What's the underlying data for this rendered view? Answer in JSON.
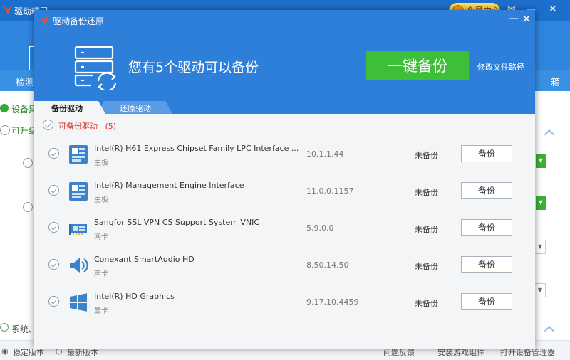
{
  "background": {
    "title": "驱动精灵",
    "vip_label": "会员中心",
    "nav": {
      "left": "检测",
      "right": "箱"
    },
    "rows": {
      "device_exception": "设备异",
      "upgradable": "可升级",
      "system": "系统、"
    },
    "statusbar": {
      "stable": "稳定版本",
      "latest": "最新版本",
      "feedback": "问题反馈",
      "install_game": "安装游戏组件",
      "device_manager": "打开设备管理器"
    }
  },
  "dialog": {
    "title": "驱动备份还原",
    "hero_text": "您有5个驱动可以备份",
    "backup_all_label": "一键备份",
    "modify_path_label": "修改文件路径",
    "tabs": [
      {
        "label": "备份驱动",
        "active": true
      },
      {
        "label": "还原驱动",
        "active": false
      }
    ],
    "section_label": "可备份驱动",
    "section_count": "(5)",
    "drivers": [
      {
        "name": "Intel(R) H61 Express Chipset Family LPC Interface ...",
        "type": "主板",
        "version": "10.1.1.44",
        "status": "未备份",
        "button": "备份",
        "icon": "motherboard-icon"
      },
      {
        "name": "Intel(R) Management Engine Interface",
        "type": "主板",
        "version": "11.0.0.1157",
        "status": "未备份",
        "button": "备份",
        "icon": "motherboard-icon"
      },
      {
        "name": "Sangfor SSL VPN CS Support System VNIC",
        "type": "网卡",
        "version": "5.9.0.0",
        "status": "未备份",
        "button": "备份",
        "icon": "network-card-icon"
      },
      {
        "name": "Conexant SmartAudio HD",
        "type": "声卡",
        "version": "8.50.14.50",
        "status": "未备份",
        "button": "备份",
        "icon": "speaker-icon"
      },
      {
        "name": "Intel(R) HD Graphics",
        "type": "显卡",
        "version": "9.17.10.4459",
        "status": "未备份",
        "button": "备份",
        "icon": "windows-logo-icon"
      }
    ]
  },
  "colors": {
    "header_blue": "#2e7fd9",
    "backup_green": "#3ebf3a",
    "section_red": "#d9332b"
  }
}
